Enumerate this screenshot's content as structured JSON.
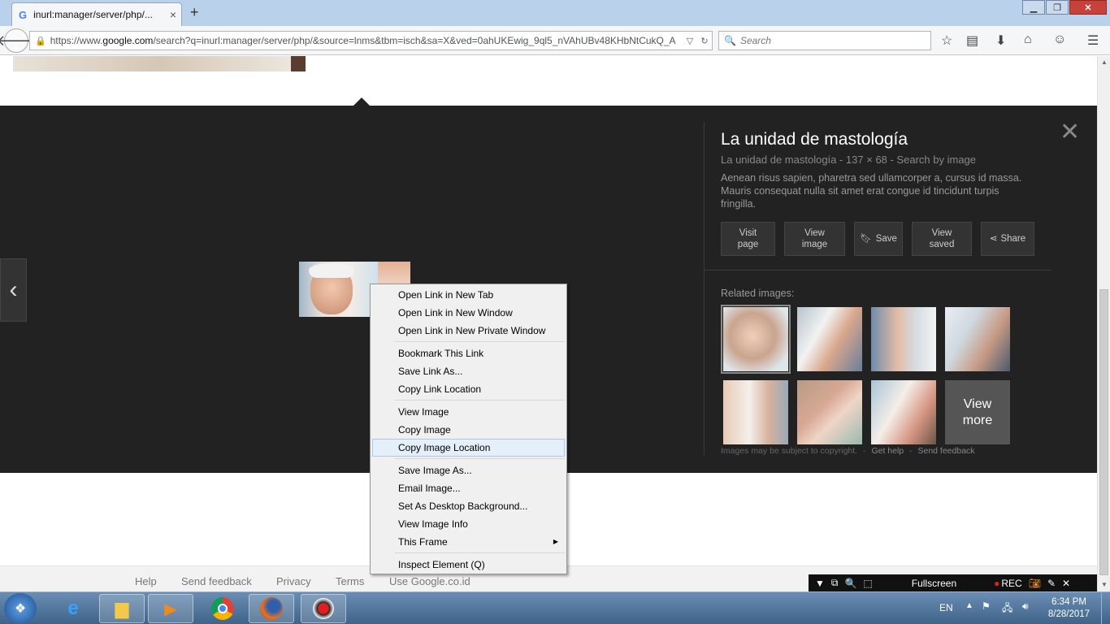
{
  "browser": {
    "tab_title": "inurl:manager/server/php/...",
    "tab_close": "×",
    "new_tab": "+",
    "url_prefix": "https://www.",
    "url_domain": "google.com",
    "url_rest": "/search?q=inurl:manager/server/php/&source=lnms&tbm=isch&sa=X&ved=0ahUKEwig_9ql5_nVAhUBv48KHbNtCukQ_A",
    "search_placeholder": "Search"
  },
  "panel": {
    "title": "La unidad de mastología",
    "meta": "La unidad de mastología - 137 × 68 - Search by image",
    "description": "Aenean risus sapien, pharetra sed ullamcorper a, cursus id massa. Mauris consequat nulla sit amet erat congue id tincidunt turpis fringilla.",
    "actions": {
      "visit_page": "Visit page",
      "view_image": "View image",
      "save": "Save",
      "view_saved": "View saved",
      "share": "Share"
    },
    "related_title": "Related images:",
    "view_more": "View more",
    "copyright": "Images may be subject to copyright.",
    "get_help": "Get help",
    "send_feedback": "Send feedback",
    "sep": "-"
  },
  "context_menu": {
    "groups": [
      [
        "Open Link in New Tab",
        "Open Link in New Window",
        "Open Link in New Private Window"
      ],
      [
        "Bookmark This Link",
        "Save Link As...",
        "Copy Link Location"
      ],
      [
        "View Image",
        "Copy Image",
        "Copy Image Location"
      ],
      [
        "Save Image As...",
        "Email Image...",
        "Set As Desktop Background...",
        "View Image Info",
        "This Frame"
      ],
      [
        "Inspect Element (Q)"
      ]
    ],
    "highlighted": "Copy Image Location"
  },
  "footer": {
    "help": "Help",
    "send_feedback": "Send feedback",
    "privacy": "Privacy",
    "terms": "Terms",
    "use_google": "Use Google.co.id"
  },
  "recorder": {
    "fullscreen": "Fullscreen",
    "rec": "REC"
  },
  "taskbar": {
    "lang": "EN",
    "time": "6:34 PM",
    "date": "8/28/2017"
  }
}
